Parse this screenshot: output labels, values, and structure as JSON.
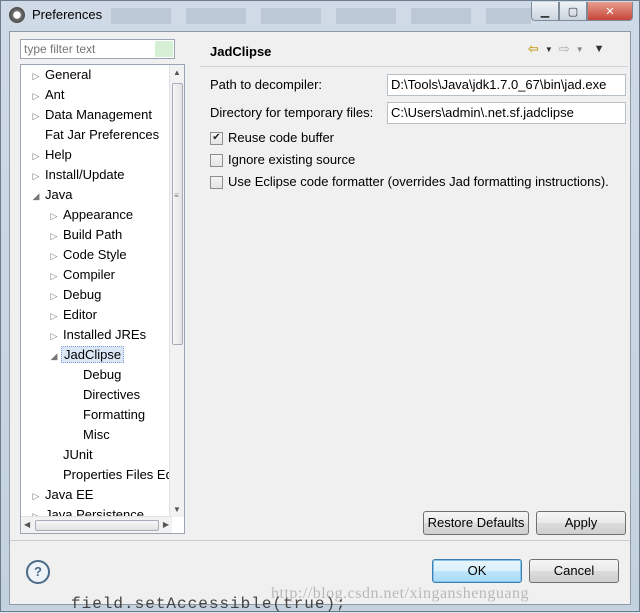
{
  "window": {
    "title": "Preferences"
  },
  "filter": {
    "placeholder": "type filter text"
  },
  "tree": [
    {
      "label": "General",
      "level": 0,
      "expander": "▷"
    },
    {
      "label": "Ant",
      "level": 0,
      "expander": "▷"
    },
    {
      "label": "Data Management",
      "level": 0,
      "expander": "▷"
    },
    {
      "label": "Fat Jar Preferences",
      "level": 0,
      "expander": ""
    },
    {
      "label": "Help",
      "level": 0,
      "expander": "▷"
    },
    {
      "label": "Install/Update",
      "level": 0,
      "expander": "▷"
    },
    {
      "label": "Java",
      "level": 0,
      "expander": "◢"
    },
    {
      "label": "Appearance",
      "level": 1,
      "expander": "▷"
    },
    {
      "label": "Build Path",
      "level": 1,
      "expander": "▷"
    },
    {
      "label": "Code Style",
      "level": 1,
      "expander": "▷"
    },
    {
      "label": "Compiler",
      "level": 1,
      "expander": "▷"
    },
    {
      "label": "Debug",
      "level": 1,
      "expander": "▷"
    },
    {
      "label": "Editor",
      "level": 1,
      "expander": "▷"
    },
    {
      "label": "Installed JREs",
      "level": 1,
      "expander": "▷"
    },
    {
      "label": "JadClipse",
      "level": 1,
      "expander": "◢",
      "selected": true
    },
    {
      "label": "Debug",
      "level": 2,
      "expander": ""
    },
    {
      "label": "Directives",
      "level": 2,
      "expander": ""
    },
    {
      "label": "Formatting",
      "level": 2,
      "expander": ""
    },
    {
      "label": "Misc",
      "level": 2,
      "expander": ""
    },
    {
      "label": "JUnit",
      "level": 1,
      "expander": ""
    },
    {
      "label": "Properties Files Ed",
      "level": 1,
      "expander": ""
    },
    {
      "label": "Java EE",
      "level": 0,
      "expander": "▷"
    },
    {
      "label": "Java Persistence",
      "level": 0,
      "expander": "▷"
    }
  ],
  "page": {
    "title": "JadClipse",
    "decompiler_label": "Path to decompiler:",
    "decompiler_value": "D:\\Tools\\Java\\jdk1.7.0_67\\bin\\jad.exe",
    "tempdir_label": "Directory for temporary files:",
    "tempdir_value": "C:\\Users\\admin\\.net.sf.jadclipse",
    "checkboxes": [
      {
        "label": "Reuse code buffer",
        "checked": true
      },
      {
        "label": "Ignore existing source",
        "checked": false
      },
      {
        "label": "Use Eclipse code formatter (overrides Jad formatting instructions).",
        "checked": false
      }
    ],
    "restore_defaults": "Restore Defaults",
    "apply": "Apply"
  },
  "footer": {
    "ok": "OK",
    "cancel": "Cancel",
    "help_glyph": "?"
  },
  "background": {
    "code_peek": "field.setAccessible(true);",
    "watermark": "http://blog.csdn.net/xinganshenguang"
  }
}
